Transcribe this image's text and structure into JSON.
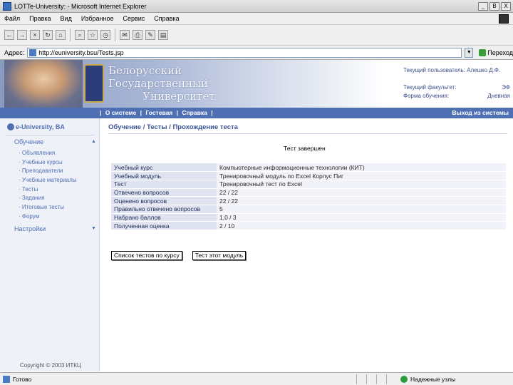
{
  "window": {
    "title": "LOTTe-University: - Microsoft Internet Explorer",
    "controls": [
      "_",
      "B",
      "X"
    ]
  },
  "menu": [
    "Файл",
    "Правка",
    "Вид",
    "Избранное",
    "Сервис",
    "Справка"
  ],
  "address": {
    "label": "Адрес:",
    "url": "http://euniversity.bsu/Tests.jsp",
    "go_label": "Переход"
  },
  "header": {
    "university": [
      "Белорусский",
      "Государственный",
      "Университет"
    ],
    "user_rows": [
      {
        "label": "Текущий пользователь: Алешко Д.Ф.",
        "value": ""
      },
      {
        "label": "Текущий факультет:",
        "value": "ЭФ"
      },
      {
        "label": "Форма обучения:",
        "value": "Дневная"
      }
    ]
  },
  "nav": {
    "links": [
      "О системе",
      "Гостевая",
      "Справка"
    ],
    "separator": "|",
    "logout": "Выход из системы"
  },
  "sidebar": {
    "brand": "e-University, BA",
    "groups": [
      {
        "label": "Обучение",
        "chevron": "▲"
      },
      {
        "label": "Настройки",
        "chevron": "▼"
      }
    ],
    "items": [
      "· Объявления",
      "· Учебные курсы",
      "· Преподаватели",
      "· Учебные материалы",
      "· Тесты",
      "· Задания",
      "· Итоговые тесты",
      "· Форум"
    ],
    "copyright": "Copyright © 2003 ИТКЦ"
  },
  "content": {
    "breadcrumb": "Обучение / Тесты / Прохождение теста",
    "status": "Тест завершен",
    "rows": [
      {
        "label": "Учебный курс",
        "value": "Компьютерные информационные технологии (КИТ)"
      },
      {
        "label": "Учебный модуль",
        "value": "Тренировочный модуль по Excel Корпус Пиг"
      },
      {
        "label": "Тест",
        "value": "Тренировочный тест по Excel"
      },
      {
        "label": "Отвечено вопросов",
        "value": "22 / 22"
      },
      {
        "label": "Оценено вопросов",
        "value": "22 / 22"
      },
      {
        "label": "Правильно отвечено вопросов",
        "value": "5"
      },
      {
        "label": "Набрано баллов",
        "value": "1,0 / 3"
      },
      {
        "label": "Полученная оценка",
        "value": "2 / 10"
      }
    ],
    "buttons": {
      "to_tests": "Список тестов по курсу",
      "to_module": "Тест этот модуль"
    }
  },
  "statusbar": {
    "left": "Готово",
    "zone": "Надежные узлы"
  }
}
